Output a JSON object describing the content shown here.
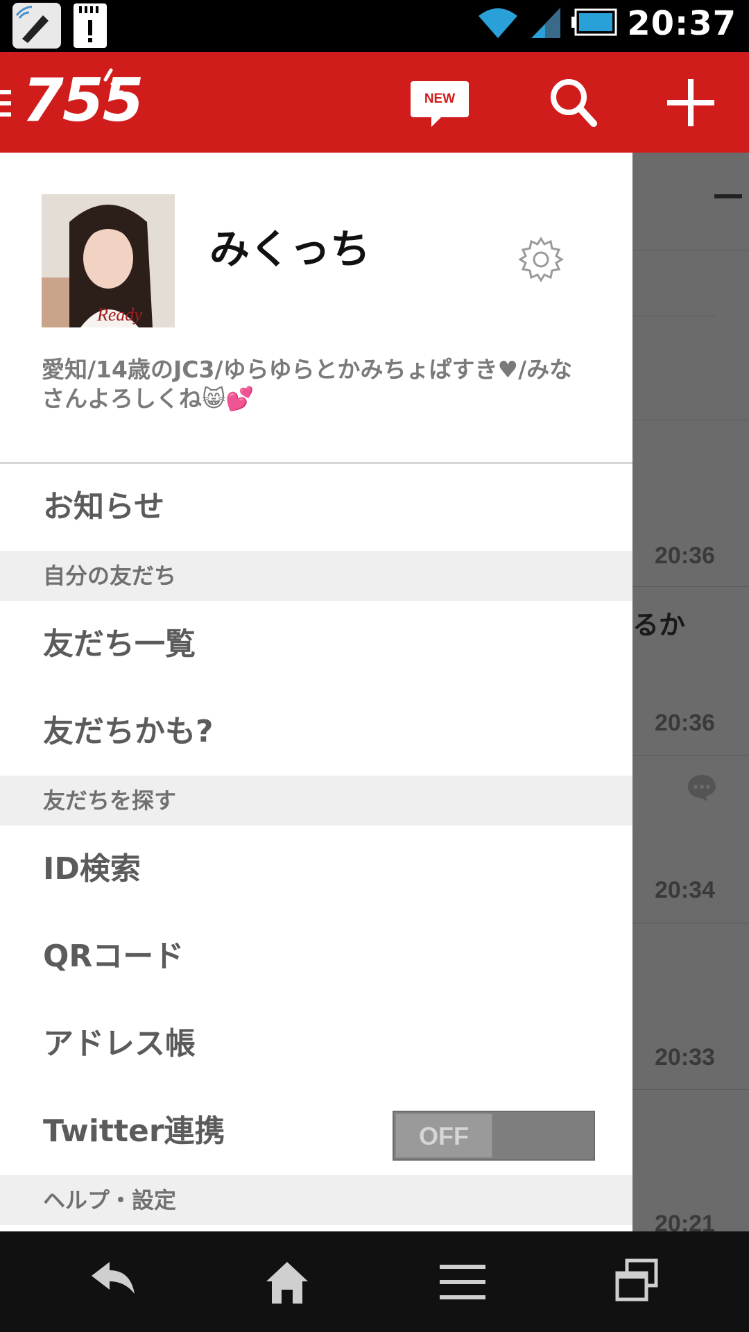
{
  "status_bar": {
    "time": "20:37",
    "icons": [
      "nfc-pen-icon",
      "sd-card-warning-icon",
      "wifi-icon",
      "signal-icon",
      "battery-icon"
    ]
  },
  "app_bar": {
    "logo": "755",
    "new_badge": "NEW",
    "accent_color": "#d11c1c"
  },
  "profile": {
    "name": "みくっち",
    "bio": "愛知/14歳のJC3/ゆらゆらとかみちょぱすき♥/みなさんよろしくね😸💕"
  },
  "menu": {
    "notifications": "お知らせ",
    "section_friends": "自分の友だち",
    "friend_list": "友だち一覧",
    "maybe_friends": "友だちかも?",
    "section_find": "友だちを探す",
    "id_search": "ID検索",
    "qr_code": "QRコード",
    "address_book": "アドレス帳",
    "twitter": "Twitter連携",
    "twitter_toggle": "OFF",
    "section_help": "ヘルプ・設定"
  },
  "background": {
    "times": [
      "20:36",
      "20:36",
      "20:34",
      "20:33",
      "20:21"
    ],
    "snippet": "るか"
  }
}
